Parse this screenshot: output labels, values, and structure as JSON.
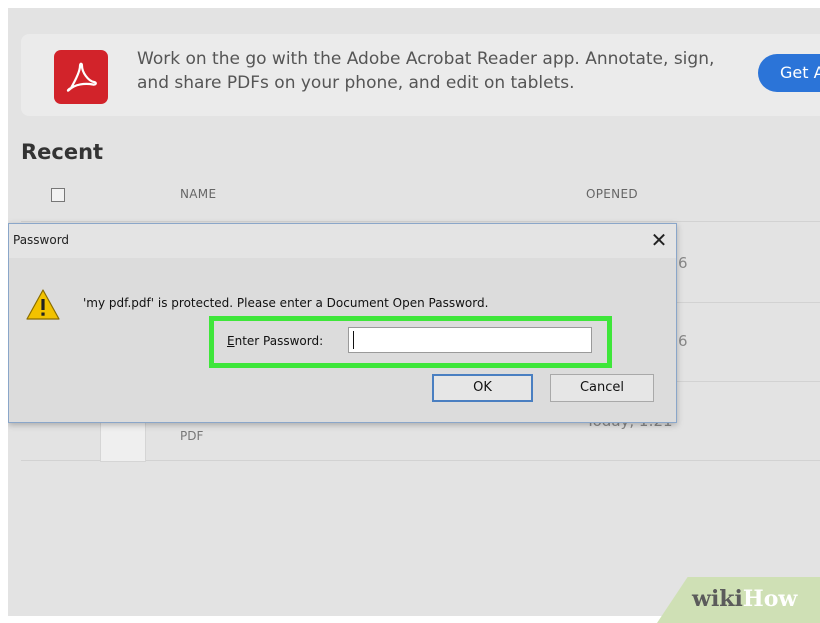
{
  "promo": {
    "text": "Work on the go with the Adobe Acrobat Reader app. Annotate, sign, and share PDFs on your phone, and edit on tablets.",
    "button_label": "Get Ap",
    "logo_icon": "acrobat-logo-icon",
    "brand_color": "#d2232a",
    "button_color": "#2b74d8"
  },
  "recent": {
    "title": "Recent",
    "columns": {
      "name": "NAME",
      "opened": "OPENED"
    },
    "background_row": {
      "type": "PDF",
      "date": "Today, 1:21"
    },
    "peek_digits": [
      "6",
      "6"
    ]
  },
  "dialog": {
    "title": "Password",
    "close_glyph": "✕",
    "message": "'my pdf.pdf' is protected. Please enter a Document Open Password.",
    "password_label_accel": "E",
    "password_label_rest": "nter Password:",
    "password_value": "",
    "ok_label": "OK",
    "cancel_label": "Cancel",
    "warning_icon": "warning-icon",
    "highlight_color": "#3ee63a"
  },
  "watermark": {
    "wiki": "wiki",
    "how": "How"
  }
}
